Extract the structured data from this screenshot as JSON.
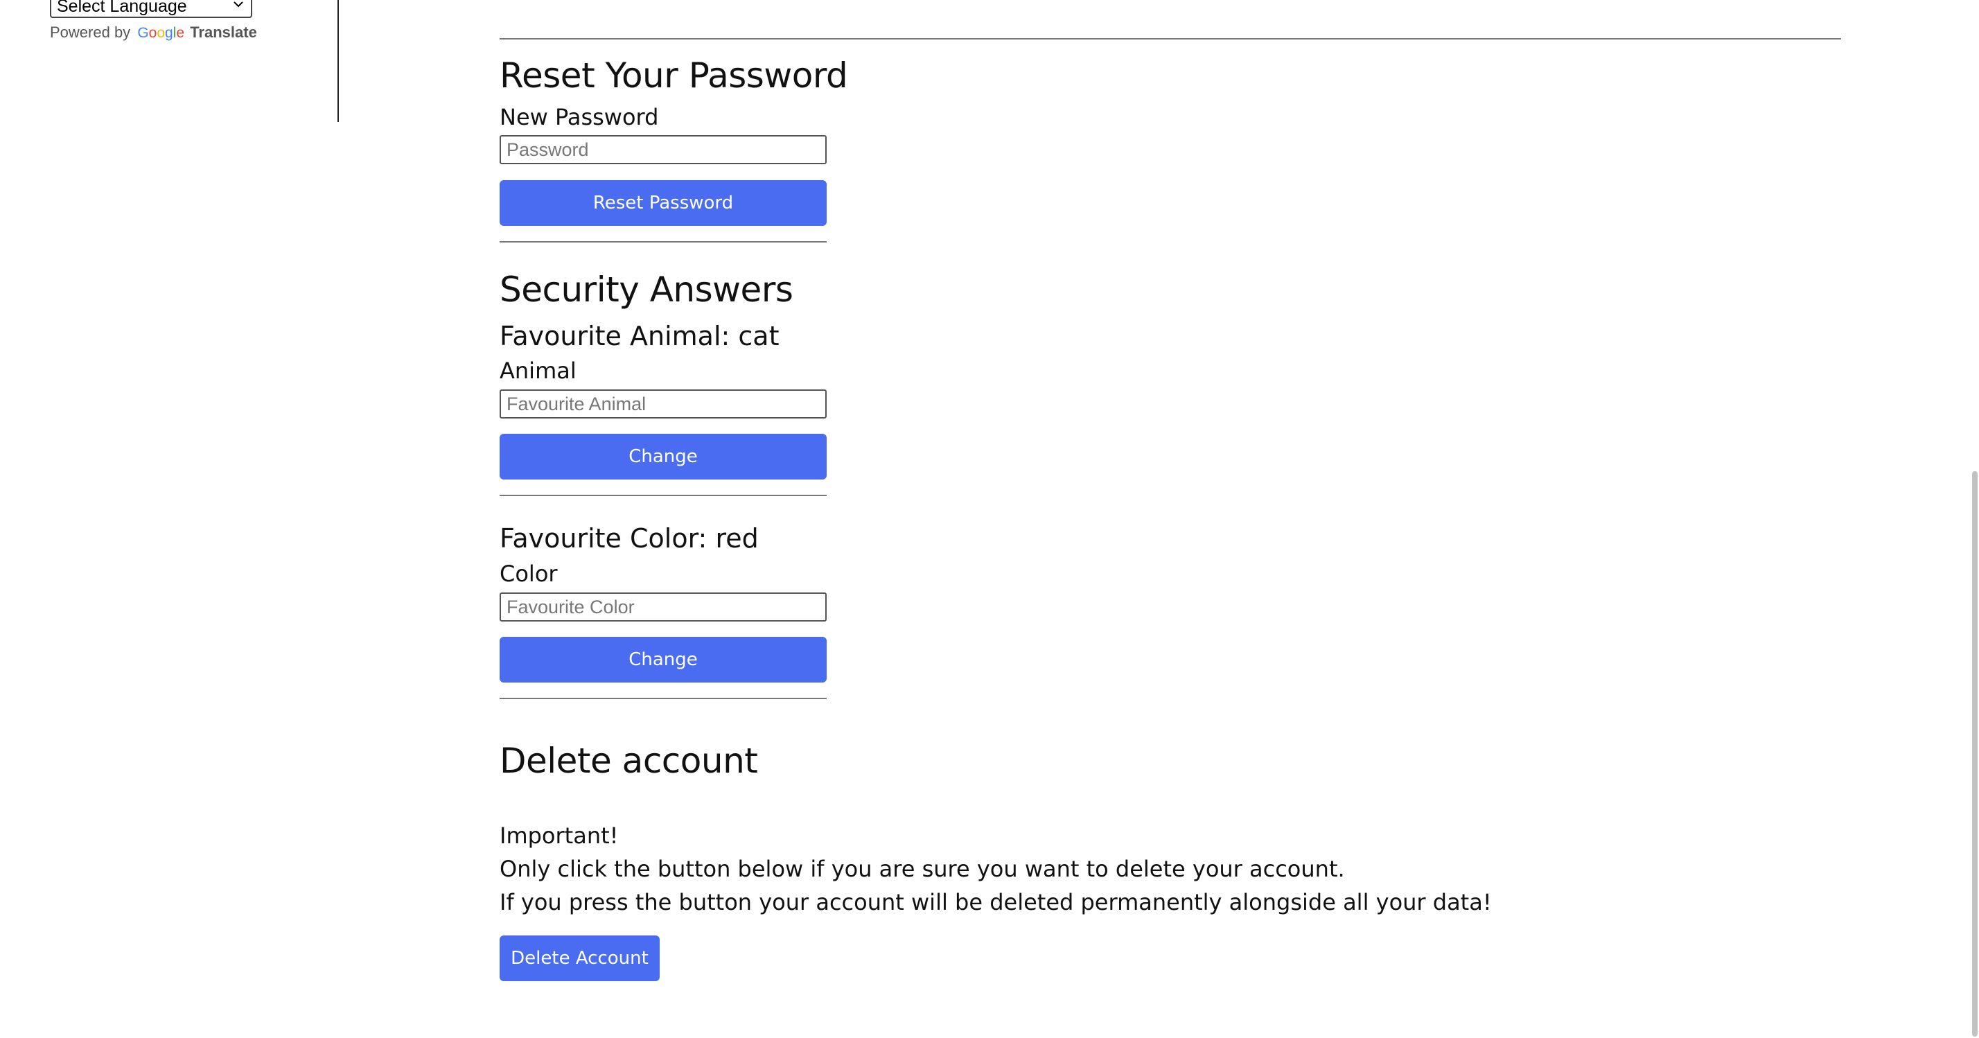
{
  "sidebar": {
    "language_select": {
      "selected": "Select Language",
      "icon": "chevron-down-icon"
    },
    "powered_by": {
      "prefix": "Powered by",
      "logo_letters": [
        "G",
        "o",
        "o",
        "g",
        "l",
        "e"
      ],
      "suffix": "Translate"
    }
  },
  "reset_password": {
    "title": "Reset Your Password",
    "field_label": "New Password",
    "field_placeholder": "Password",
    "button_label": "Reset Password"
  },
  "security": {
    "title": "Security Answers",
    "animal": {
      "heading": "Favourite Animal: cat",
      "field_label": "Animal",
      "field_placeholder": "Favourite Animal",
      "button_label": "Change"
    },
    "color": {
      "heading": "Favourite Color: red",
      "field_label": "Color",
      "field_placeholder": "Favourite Color",
      "button_label": "Change"
    }
  },
  "delete_account": {
    "title": "Delete account",
    "warning_line_1": "Important!",
    "warning_line_2": "Only click the button below if you are sure you want to delete your account.",
    "warning_line_3": "If you press the button your account will be deleted permanently alongside all your data!",
    "button_label": "Delete Account"
  },
  "colors": {
    "button_blue": "#4a6cf0",
    "divider_gray": "#777777"
  }
}
